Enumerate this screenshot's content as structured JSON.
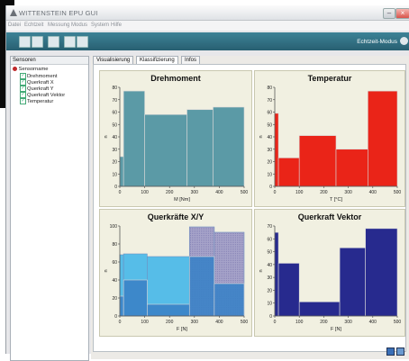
{
  "window": {
    "title": "WITTENSTEIN EPU GUI"
  },
  "menu": [
    "Datei",
    "Echtzeit",
    "Messung",
    "Modus",
    "System",
    "Hilfe"
  ],
  "toolbar": {
    "mode_label": "Echtzeit-Modus"
  },
  "sidebar": {
    "header": "Sensoren",
    "root": "Sensorname",
    "items": [
      "Drehmoment",
      "Querkraft X",
      "Querkraft Y",
      "Querkraft Vektor",
      "Temperatur"
    ]
  },
  "tabs": [
    "Visualisierung",
    "Klassifizierung",
    "Infos"
  ],
  "active_tab": "Klassifizierung",
  "colors": {
    "toolbar": "#2f6f82",
    "teal": "#5b9aa6",
    "red": "#ea2418",
    "navy": "#272a8e",
    "lightblue": "#56bde8",
    "midblue": "#3b82c6"
  },
  "chart_data": [
    {
      "type": "bar",
      "title": "Drehmoment",
      "xlabel": "M [Nm]",
      "ylabel": "n",
      "xlim": [
        0,
        500
      ],
      "ylim": [
        0,
        80
      ],
      "xticks": [
        0,
        100,
        200,
        300,
        400,
        500
      ],
      "yticks": [
        0,
        10,
        20,
        30,
        40,
        50,
        60,
        70,
        80
      ],
      "bins": [
        {
          "x0": 0,
          "x1": 15,
          "value": 24
        },
        {
          "x0": 15,
          "x1": 100,
          "value": 77
        },
        {
          "x0": 100,
          "x1": 270,
          "value": 58
        },
        {
          "x0": 270,
          "x1": 375,
          "value": 62
        },
        {
          "x0": 375,
          "x1": 500,
          "value": 64
        }
      ],
      "color": "#5b9aa6"
    },
    {
      "type": "bar",
      "title": "Temperatur",
      "xlabel": "T [°C]",
      "ylabel": "n",
      "xlim": [
        0,
        500
      ],
      "ylim": [
        0,
        80
      ],
      "xticks": [
        0,
        100,
        200,
        300,
        400,
        500
      ],
      "yticks": [
        0,
        10,
        20,
        30,
        40,
        50,
        60,
        70,
        80
      ],
      "bins": [
        {
          "x0": 0,
          "x1": 15,
          "value": 59
        },
        {
          "x0": 15,
          "x1": 100,
          "value": 23
        },
        {
          "x0": 100,
          "x1": 250,
          "value": 41
        },
        {
          "x0": 250,
          "x1": 380,
          "value": 30
        },
        {
          "x0": 380,
          "x1": 500,
          "value": 77
        }
      ],
      "color": "#ea2418"
    },
    {
      "type": "bar",
      "title": "Querkräfte X/Y",
      "xlabel": "F [N]",
      "ylabel": "n",
      "xlim": [
        0,
        500
      ],
      "ylim": [
        0,
        100
      ],
      "xticks": [
        0,
        100,
        200,
        300,
        400,
        500
      ],
      "yticks": [
        0,
        20,
        40,
        60,
        80,
        100
      ],
      "series": [
        {
          "name": "X",
          "color": "#56bde8",
          "bins": [
            {
              "x0": 0,
              "x1": 15,
              "value": 68
            },
            {
              "x0": 15,
              "x1": 110,
              "value": 69
            },
            {
              "x0": 110,
              "x1": 280,
              "value": 66
            },
            {
              "x0": 280,
              "x1": 380,
              "value": 99
            },
            {
              "x0": 380,
              "x1": 500,
              "value": 93
            }
          ]
        },
        {
          "name": "Y",
          "color": "#3b82c6",
          "bins": [
            {
              "x0": 0,
              "x1": 15,
              "value": 22
            },
            {
              "x0": 15,
              "x1": 110,
              "value": 40
            },
            {
              "x0": 110,
              "x1": 280,
              "value": 13
            },
            {
              "x0": 280,
              "x1": 380,
              "value": 66
            },
            {
              "x0": 380,
              "x1": 500,
              "value": 36
            }
          ]
        }
      ]
    },
    {
      "type": "bar",
      "title": "Querkraft Vektor",
      "xlabel": "F [N]",
      "ylabel": "n",
      "xlim": [
        0,
        500
      ],
      "ylim": [
        0,
        70
      ],
      "xticks": [
        0,
        100,
        200,
        300,
        400,
        500
      ],
      "yticks": [
        0,
        10,
        20,
        30,
        40,
        50,
        60,
        70
      ],
      "bins": [
        {
          "x0": 0,
          "x1": 15,
          "value": 65
        },
        {
          "x0": 15,
          "x1": 100,
          "value": 41
        },
        {
          "x0": 100,
          "x1": 265,
          "value": 11
        },
        {
          "x0": 265,
          "x1": 370,
          "value": 53
        },
        {
          "x0": 370,
          "x1": 500,
          "value": 68
        }
      ],
      "color": "#272a8e"
    }
  ]
}
